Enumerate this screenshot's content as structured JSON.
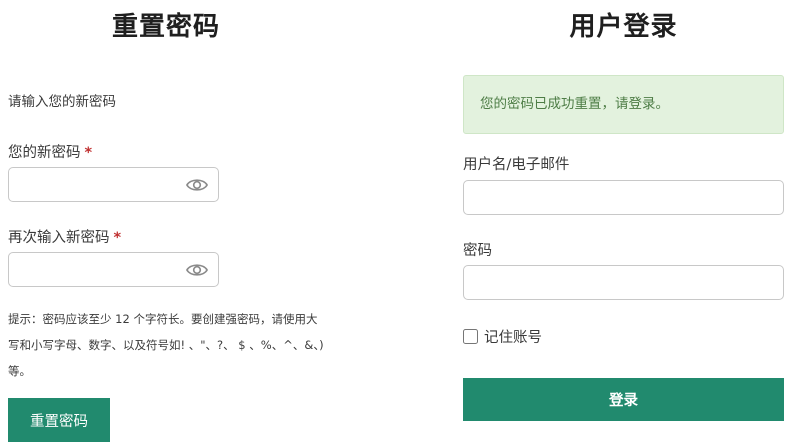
{
  "reset": {
    "title": "重置密码",
    "intro": "请输入您的新密码",
    "new_password_label": "您的新密码",
    "confirm_password_label": "再次输入新密码",
    "required_mark": "*",
    "hint": "提示：密码应该至少 12 个字符长。要创建强密码，请使用大写和小写字母、数字、以及符号如! 、\"、?、 $ 、%、^、&、) 等。",
    "submit_label": "重置密码",
    "show_password_icon": "eye-icon"
  },
  "login": {
    "title": "用户登录",
    "success_message": "您的密码已成功重置，请登录。",
    "username_label": "用户名/电子邮件",
    "username_value": "",
    "password_label": "密码",
    "password_value": "",
    "remember_label": "记住账号",
    "remember_checked": false,
    "submit_label": "登录"
  },
  "colors": {
    "primary": "#218a6e",
    "success_bg": "#e3f2de",
    "success_text": "#4e7d46",
    "required": "#c03030"
  }
}
